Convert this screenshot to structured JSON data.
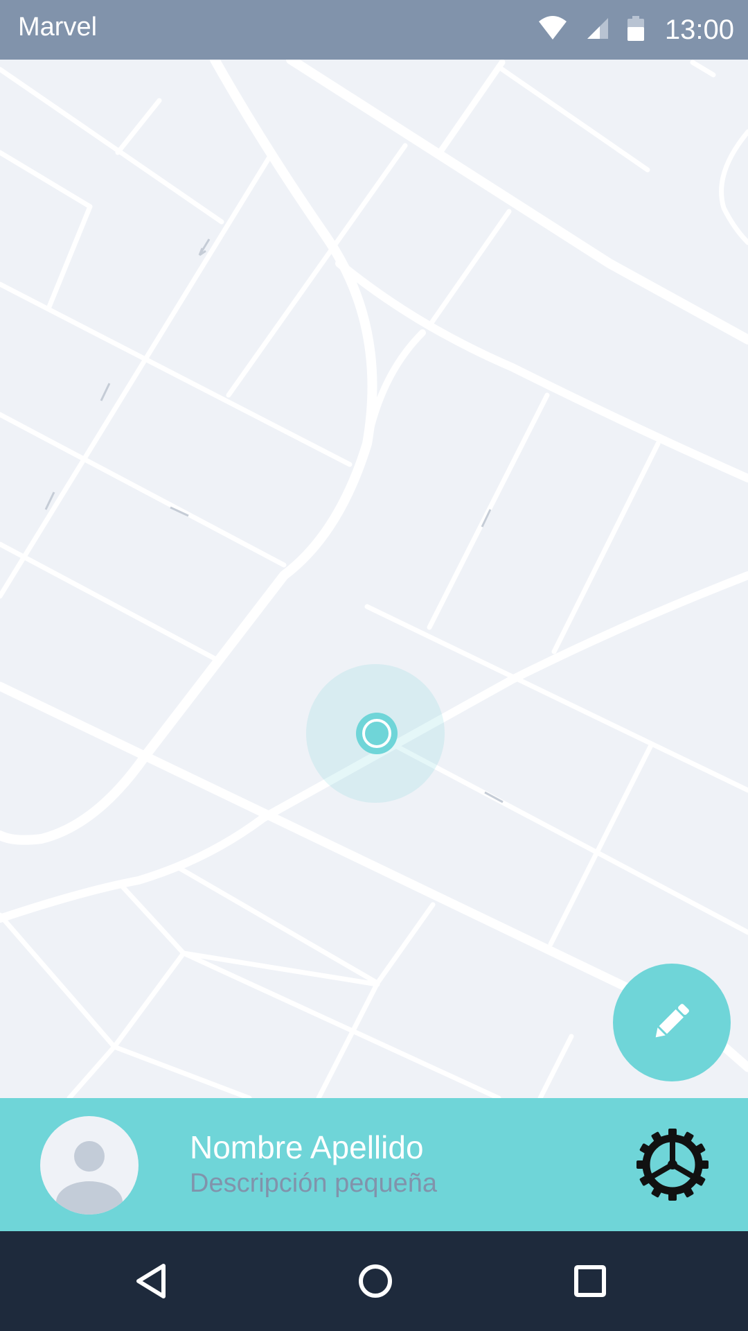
{
  "status_bar": {
    "title": "Marvel",
    "time": "13:00",
    "icons": [
      "wifi-icon",
      "signal-icon",
      "battery-icon"
    ]
  },
  "map": {
    "location_marker": "current-location",
    "colors": {
      "background": "#eff2f7",
      "road": "#ffffff",
      "accent": "#6fd5d8"
    }
  },
  "fab": {
    "icon": "pencil-icon"
  },
  "profile": {
    "name": "Nombre Apellido",
    "description": "Descripción pequeña",
    "avatar_icon": "person-icon",
    "settings_icon": "gear-icon"
  },
  "nav_bar": {
    "icons": [
      "back-icon",
      "home-icon",
      "recents-icon"
    ]
  }
}
